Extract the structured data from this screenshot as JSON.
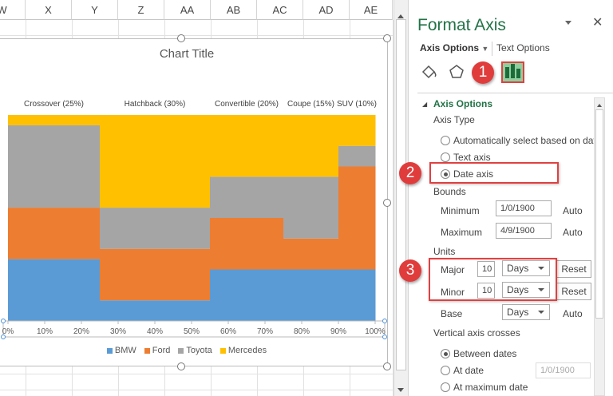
{
  "sheet": {
    "columns": [
      "W",
      "X",
      "Y",
      "Z",
      "AA",
      "AB",
      "AC",
      "AD",
      "AE"
    ]
  },
  "chart": {
    "title": "Chart Title",
    "legend": [
      {
        "name": "BMW",
        "color": "#5b9bd5"
      },
      {
        "name": "Ford",
        "color": "#ed7d31"
      },
      {
        "name": "Toyota",
        "color": "#a5a5a5"
      },
      {
        "name": "Mercedes",
        "color": "#ffc000"
      }
    ]
  },
  "chart_data": {
    "type": "area",
    "subtype": "stacked step area (mekko)",
    "title": "Chart Title",
    "x_ticks": [
      "0%",
      "10%",
      "20%",
      "30%",
      "40%",
      "50%",
      "60%",
      "70%",
      "80%",
      "90%",
      "100%"
    ],
    "xlim": [
      0,
      100
    ],
    "ylim": [
      0,
      100
    ],
    "grid": false,
    "legend_position": "bottom",
    "categories": [
      {
        "label": "Crossover (25%)",
        "start": 0,
        "end": 25
      },
      {
        "label": "Hatchback (30%)",
        "start": 25,
        "end": 55
      },
      {
        "label": "Convertible (20%)",
        "start": 55,
        "end": 75
      },
      {
        "label": "Coupe (15%)",
        "start": 75,
        "end": 90
      },
      {
        "label": "SUV (10%)",
        "start": 90,
        "end": 100
      }
    ],
    "series": [
      {
        "name": "BMW",
        "color": "#5b9bd5",
        "values": [
          30,
          10,
          25,
          25,
          25
        ]
      },
      {
        "name": "Ford",
        "color": "#ed7d31",
        "values": [
          25,
          25,
          25,
          15,
          50
        ]
      },
      {
        "name": "Toyota",
        "color": "#a5a5a5",
        "values": [
          40,
          20,
          20,
          30,
          10
        ]
      },
      {
        "name": "Mercedes",
        "color": "#ffc000",
        "values": [
          5,
          45,
          30,
          30,
          15
        ]
      }
    ]
  },
  "panel": {
    "title": "Format Axis",
    "tab_axis": "Axis Options",
    "tab_text": "Text Options",
    "icons": [
      "fill-line-icon",
      "effects-icon",
      "axis-options-chart-icon"
    ],
    "section": "Axis Options",
    "axis_type_label": "Axis Type",
    "opt_auto": "Automatically select based on data",
    "opt_text": "Text axis",
    "opt_date": "Date axis",
    "bounds_label": "Bounds",
    "min_label": "Minimum",
    "min_value": "1/0/1900",
    "min_auto": "Auto",
    "max_label": "Maximum",
    "max_value": "4/9/1900",
    "max_auto": "Auto",
    "units_label": "Units",
    "major_label": "Major",
    "major_value": "10",
    "major_unit": "Days",
    "major_reset": "Reset",
    "minor_label": "Minor",
    "minor_value": "10",
    "minor_unit": "Days",
    "minor_reset": "Reset",
    "base_label": "Base",
    "base_unit": "Days",
    "base_auto": "Auto",
    "crosses_label": "Vertical axis crosses",
    "cross_between": "Between dates",
    "cross_at": "At date",
    "cross_at_value": "1/0/1900",
    "cross_max": "At maximum date",
    "badges": [
      "1",
      "2",
      "3"
    ],
    "accent": "#217346",
    "highlight": "#e04040"
  }
}
